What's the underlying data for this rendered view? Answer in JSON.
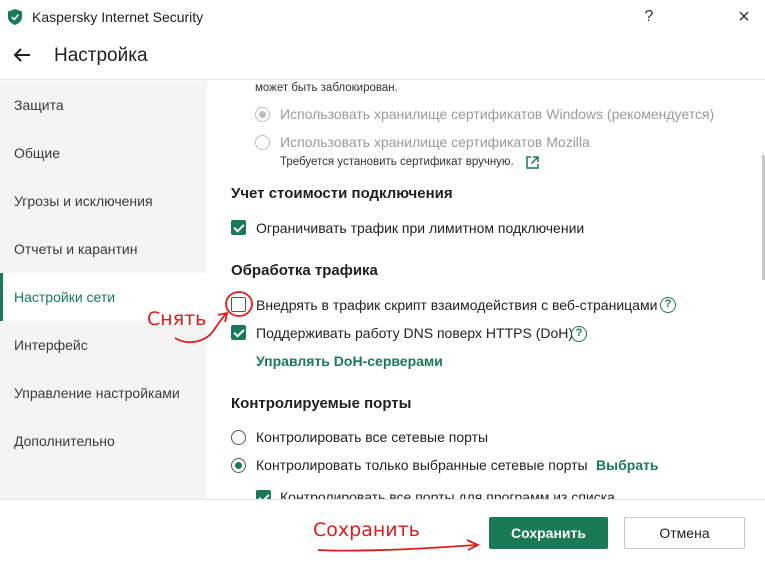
{
  "window": {
    "title": "Kaspersky Internet Security",
    "help": "?",
    "close": "×"
  },
  "header": {
    "title": "Настройка"
  },
  "sidebar": {
    "items": [
      {
        "label": "Защита"
      },
      {
        "label": "Общие"
      },
      {
        "label": "Угрозы и исключения"
      },
      {
        "label": "Отчеты и карантин"
      },
      {
        "label": "Настройки сети",
        "active": true
      },
      {
        "label": "Интерфейс"
      },
      {
        "label": "Управление настройками"
      },
      {
        "label": "Дополнительно"
      }
    ]
  },
  "content": {
    "top_text": "может быть заблокирован.",
    "cert_windows": "Использовать хранилище сертификатов Windows (рекомендуется)",
    "cert_mozilla": "Использовать хранилище сертификатов Mozilla",
    "cert_note": "Требуется установить сертификат вручную.",
    "metered": {
      "title": "Учет стоимости подключения",
      "limit_traffic": "Ограничивать трафик при лимитном подключении"
    },
    "traffic": {
      "title": "Обработка трафика",
      "inject_script": "Внедрять в трафик скрипт взаимодействия с веб-страницами",
      "dns_https": "Поддерживать работу DNS поверх HTTPS (DoH)",
      "manage_doh": "Управлять DoH-серверами"
    },
    "ports": {
      "title": "Контролируемые порты",
      "all_ports": "Контролировать все сетевые порты",
      "selected_ports": "Контролировать только выбранные сетевые порты",
      "choose": "Выбрать",
      "all_ports_programs": "Контролировать все порты для программ из списка"
    }
  },
  "footer": {
    "save": "Сохранить",
    "cancel": "Отмена"
  },
  "annotations": {
    "uncheck": "Снять",
    "save": "Сохранить"
  },
  "colors": {
    "accent": "#1a7a57",
    "annotation": "#e01b1b"
  }
}
